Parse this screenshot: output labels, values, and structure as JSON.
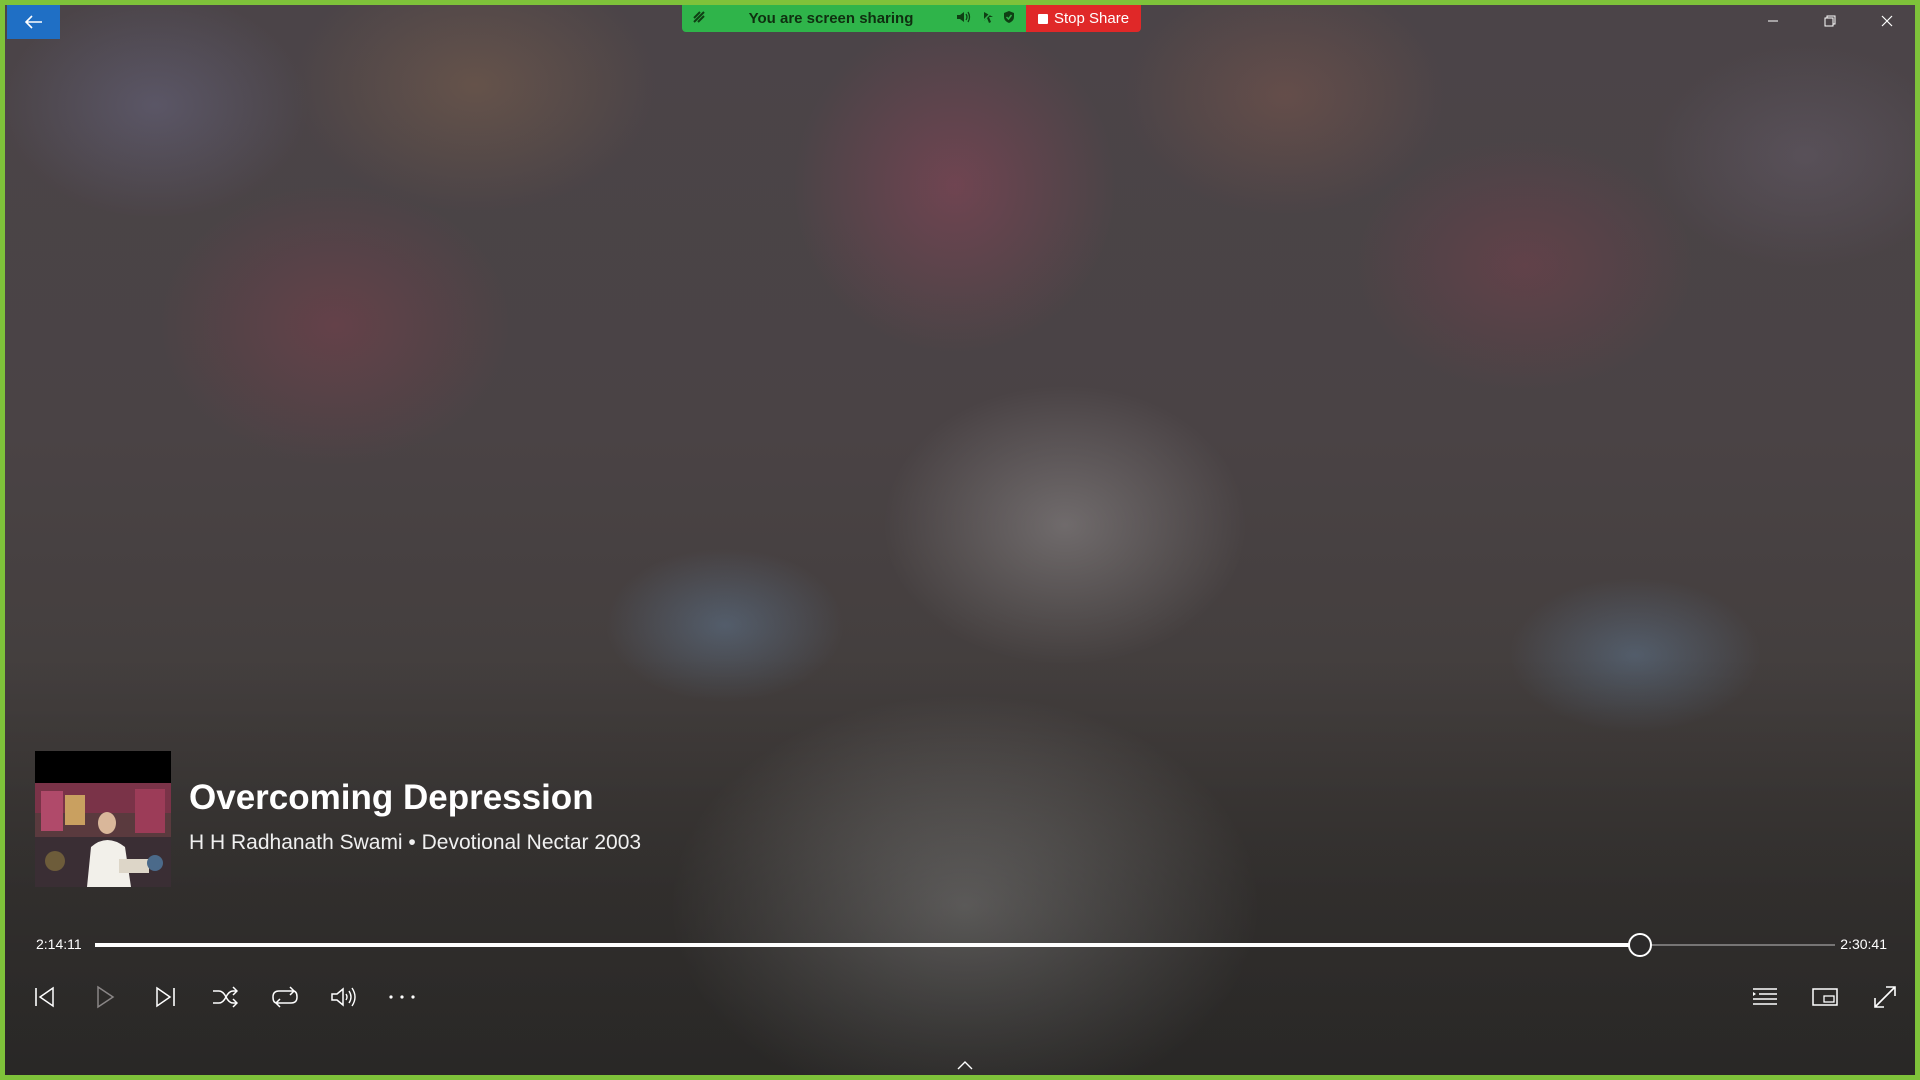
{
  "share_banner": {
    "status_text": "You are screen sharing",
    "stop_label": "Stop Share"
  },
  "now_playing": {
    "title": "Overcoming Depression",
    "subtitle": "H H Radhanath Swami • Devotional Nectar 2003"
  },
  "progress": {
    "elapsed": "2:14:11",
    "total": "2:30:41",
    "fraction": 0.888
  },
  "controls": {
    "left": [
      "previous-icon",
      "play-icon",
      "next-icon",
      "shuffle-icon",
      "repeat-icon",
      "volume-icon",
      "more-icon"
    ],
    "right": [
      "now-playing-list-icon",
      "mini-view-icon",
      "full-screen-icon"
    ]
  },
  "colors": {
    "border": "#7ec23a",
    "back_button": "#1f6fc5",
    "share_green": "#2fb44a",
    "stop_red": "#e02828"
  }
}
